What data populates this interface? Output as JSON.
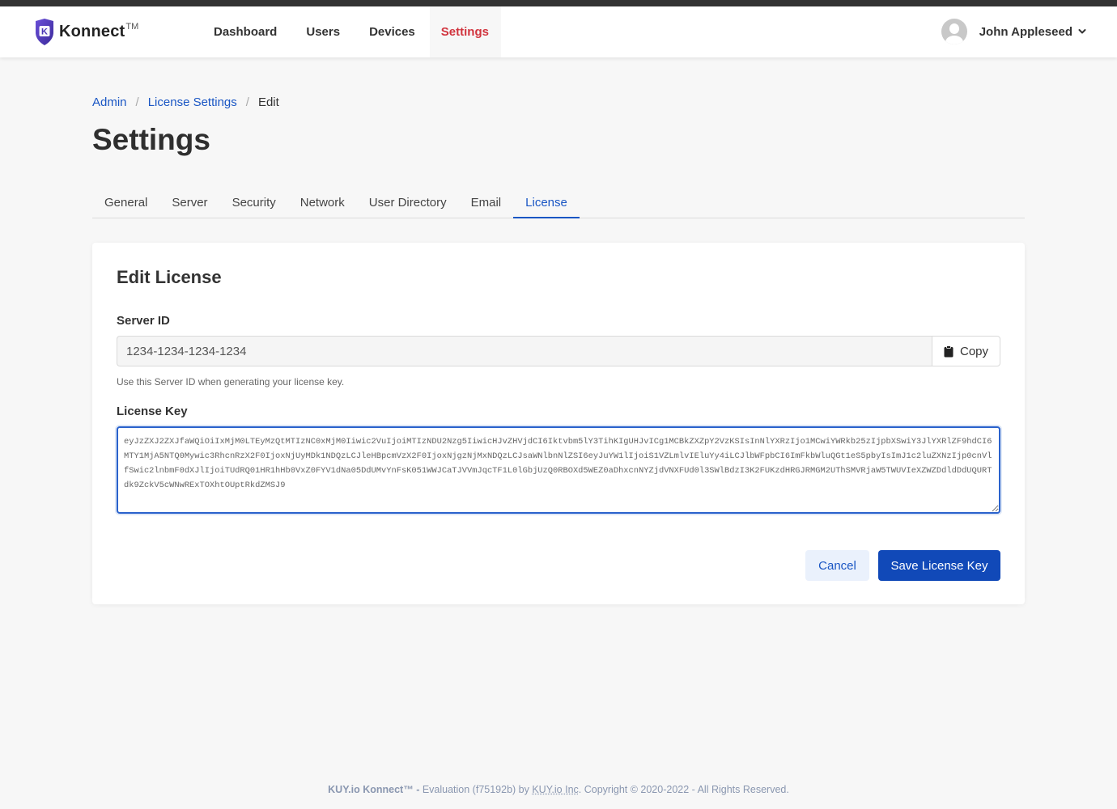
{
  "header": {
    "brand_name": "Konnect",
    "brand_tm": "TM",
    "logo_letter": "K",
    "nav": [
      {
        "label": "Dashboard",
        "active": false
      },
      {
        "label": "Users",
        "active": false
      },
      {
        "label": "Devices",
        "active": false
      },
      {
        "label": "Settings",
        "active": true
      }
    ],
    "user_name": "John Appleseed"
  },
  "breadcrumb": {
    "items": [
      {
        "label": "Admin",
        "link": true
      },
      {
        "label": "License Settings",
        "link": true
      },
      {
        "label": "Edit",
        "link": false
      }
    ],
    "separator": "/"
  },
  "page_title": "Settings",
  "tabs": [
    {
      "label": "General",
      "active": false
    },
    {
      "label": "Server",
      "active": false
    },
    {
      "label": "Security",
      "active": false
    },
    {
      "label": "Network",
      "active": false
    },
    {
      "label": "User Directory",
      "active": false
    },
    {
      "label": "Email",
      "active": false
    },
    {
      "label": "License",
      "active": true
    }
  ],
  "card": {
    "title": "Edit License",
    "server_id": {
      "label": "Server ID",
      "value": "1234-1234-1234-1234",
      "copy_label": "Copy",
      "help": "Use this Server ID when generating your license key."
    },
    "license_key": {
      "label": "License Key",
      "value": "eyJzZXJ2ZXJfaWQiOiIxMjM0LTEyMzQtMTIzNC0xMjM0Iiwic2VuIjoiMTIzNDU2Nzg5IiwicHJvZHVjdCI6Iktvbm5lY3TihKIgUHJvICg1MCBkZXZpY2VzKSIsInNlYXRzIjo1MCwiYWRkb25zIjpbXSwiY3JlYXRlZF9hdCI6MTY1MjA5NTQ0Mywic3RhcnRzX2F0IjoxNjUyMDk1NDQzLCJleHBpcmVzX2F0IjoxNjgzNjMxNDQzLCJsaWNlbnNlZSI6eyJuYW1lIjoiS1VZLmlvIEluYy4iLCJlbWFpbCI6ImFkbWluQGt1eS5pbyIsImJ1c2luZXNzIjp0cnVlfSwic2lnbmF0dXJlIjoiTUdRQ01HR1hHb0VxZ0FYV1dNa05DdUMvYnFsK051WWJCaTJVVmJqcTF1L0lGbjUzQ0RBOXd5WEZ0aDhxcnNYZjdVNXFUd0l3SWlBdzI3K2FUKzdHRGJRMGM2UThSMVRjaW5TWUVIeXZWZDdldDdUQURTdk9ZckV5cWNwRExTOXhtOUptRkdZMSJ9"
    },
    "cancel_label": "Cancel",
    "save_label": "Save License Key"
  },
  "footer": {
    "product": "KUY.io Konnect™ -",
    "edition_text": " Evaluation (f75192b) by ",
    "company": "KUY.io Inc",
    "copyright": ". Copyright © 2020-2022 - All Rights Reserved."
  },
  "colors": {
    "accent_blue": "#1a56c4",
    "primary_button": "#1149b8",
    "active_nav_red": "#d1343e",
    "logo_purple": "#5b3fc4"
  }
}
